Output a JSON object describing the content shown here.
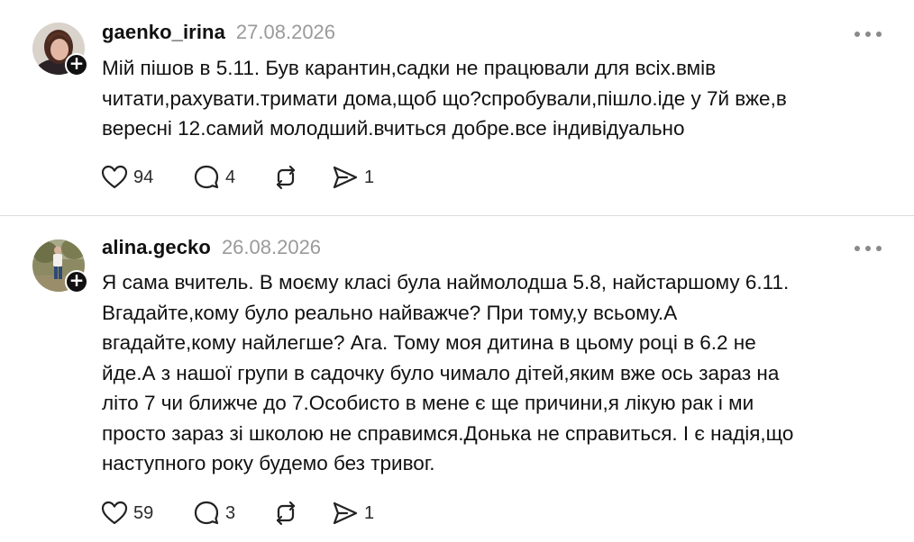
{
  "posts": [
    {
      "username": "gaenko_irina",
      "date": "27.08.2026",
      "text": "Мій пішов в 5.11. Був карантин,садки не працювали для всіх.вмів\nчитати,рахувати.тримати дома,щоб що?спробували,пішло.іде у 7й вже,в\nвересні 12.самий молодший.вчиться добре.все індивідуально",
      "likes": "94",
      "replies": "4",
      "shares": "1"
    },
    {
      "username": "alina.gecko",
      "date": "26.08.2026",
      "text": "Я сама вчитель. В моєму класі була наймолодша 5.8, найстаршому 6.11.\nВгадайте,кому було реально найважче? При тому,у всьому.А\nвгадайте,кому найлегше? Ага. Тому моя дитина в цьому році в 6.2 не\nйде.А з нашої групи в садочку було чимало дітей,яким вже ось зараз на\nліто 7 чи ближче до 7.Особисто в мене є ще причини,я лікую рак і ми\nпросто зараз зі школою не справимся.Донька не справиться. І є надія,що\nнаступного року будемо без тривог.",
      "likes": "59",
      "replies": "3",
      "shares": "1"
    }
  ],
  "icons": {
    "like": "heart-icon",
    "reply": "comment-icon",
    "repost": "repost-icon",
    "share": "share-icon",
    "more": "more-icon",
    "follow": "plus-icon"
  },
  "colors": {
    "text": "#101010",
    "muted": "#9a9a9a",
    "divider": "#dcdcdc"
  }
}
